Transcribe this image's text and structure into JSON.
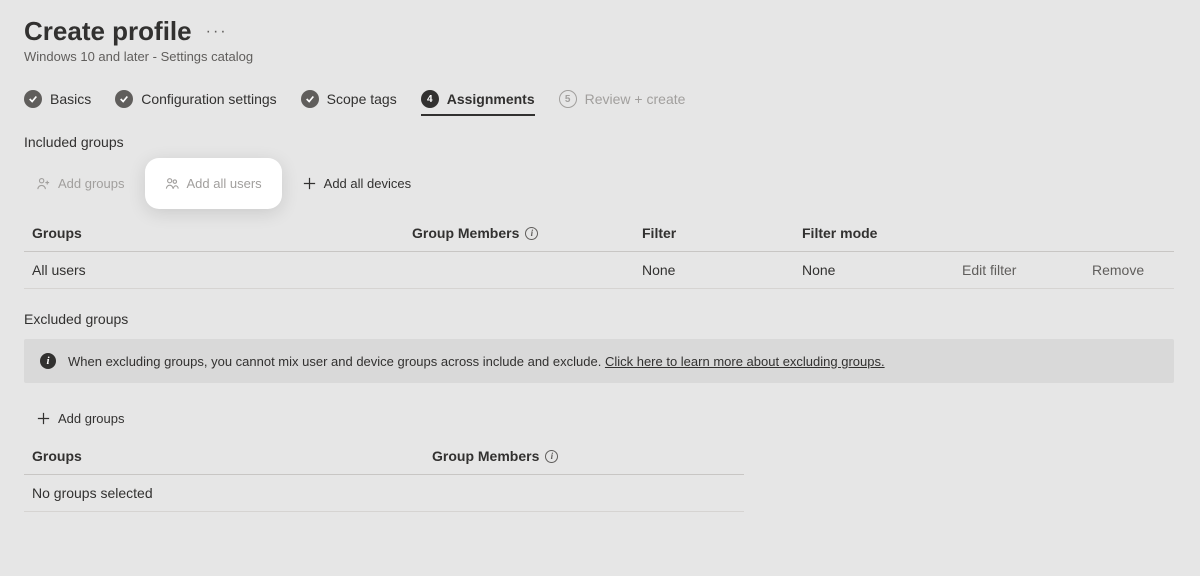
{
  "header": {
    "title": "Create profile",
    "subtitle": "Windows 10 and later - Settings catalog"
  },
  "steps": {
    "s1": "Basics",
    "s2": "Configuration settings",
    "s3": "Scope tags",
    "s4": "Assignments",
    "s4_num": "4",
    "s5": "Review + create",
    "s5_num": "5"
  },
  "included": {
    "label": "Included groups",
    "actions": {
      "add_groups": "Add groups",
      "add_all_users": "Add all users",
      "add_all_devices": "Add all devices"
    },
    "columns": {
      "groups": "Groups",
      "members": "Group Members",
      "filter": "Filter",
      "filter_mode": "Filter mode"
    },
    "rows": [
      {
        "group": "All users",
        "members": "",
        "filter": "None",
        "filter_mode": "None",
        "edit": "Edit filter",
        "remove": "Remove"
      }
    ]
  },
  "excluded": {
    "label": "Excluded groups",
    "callout": {
      "text": "When excluding groups, you cannot mix user and device groups across include and exclude. ",
      "link": "Click here to learn more about excluding groups."
    },
    "actions": {
      "add_groups": "Add groups"
    },
    "columns": {
      "groups": "Groups",
      "members": "Group Members"
    },
    "empty": "No groups selected"
  }
}
